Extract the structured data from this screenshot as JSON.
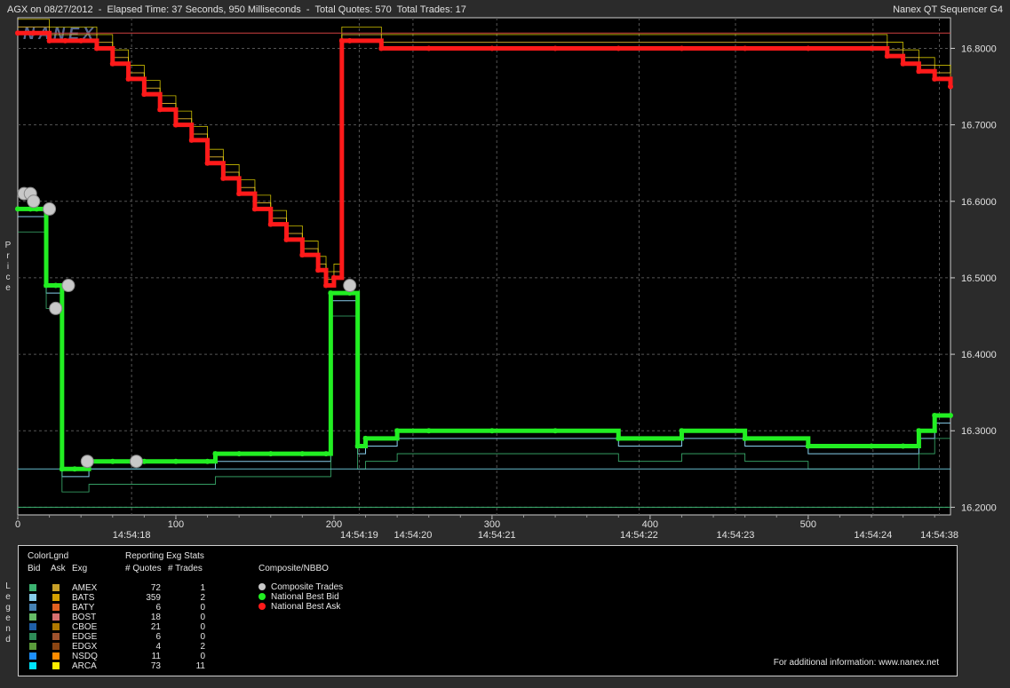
{
  "header": {
    "left_text": "AGX on 08/27/2012  -  Elapsed Time: 37 Seconds, 950 Milliseconds  -  Total Quotes: 570  Total Trades: 17",
    "right_text": "Nanex QT Sequencer G4"
  },
  "watermark": "NANEX",
  "y_axis_label": "Price",
  "legend_side_label": "Legend",
  "chart_data": {
    "type": "line",
    "x_range": [
      0,
      590
    ],
    "y_range": [
      16.19,
      16.84
    ],
    "grid": true,
    "y_ticks": [
      {
        "value": 16.8,
        "label": "16.8000"
      },
      {
        "value": 16.7,
        "label": "16.7000"
      },
      {
        "value": 16.6,
        "label": "16.6000"
      },
      {
        "value": 16.5,
        "label": "16.5000"
      },
      {
        "value": 16.4,
        "label": "16.4000"
      },
      {
        "value": 16.3,
        "label": "16.3000"
      },
      {
        "value": 16.2,
        "label": "16.2000"
      }
    ],
    "x_ticks": [
      {
        "value": 0,
        "label": "0"
      },
      {
        "value": 100,
        "label": "100"
      },
      {
        "value": 200,
        "label": "200"
      },
      {
        "value": 300,
        "label": "300"
      },
      {
        "value": 400,
        "label": "400"
      },
      {
        "value": 500,
        "label": "500"
      }
    ],
    "time_labels": [
      {
        "value": 72,
        "label": "14:54:18"
      },
      {
        "value": 216,
        "label": "14:54:19"
      },
      {
        "value": 250,
        "label": "14:54:20"
      },
      {
        "value": 303,
        "label": "14:54:21"
      },
      {
        "value": 393,
        "label": "14:54:22"
      },
      {
        "value": 454,
        "label": "14:54:23"
      },
      {
        "value": 541,
        "label": "14:54:24"
      },
      {
        "value": 583,
        "label": "14:54:38"
      }
    ],
    "series": [
      {
        "name": "National Best Ask",
        "color": "#ff1a1a",
        "x": [
          0,
          10,
          20,
          30,
          40,
          50,
          60,
          70,
          80,
          90,
          100,
          110,
          120,
          130,
          140,
          150,
          160,
          170,
          180,
          190,
          195,
          200,
          205,
          210,
          230,
          260,
          300,
          340,
          380,
          420,
          460,
          500,
          540,
          550,
          560,
          570,
          580,
          590
        ],
        "y": [
          16.82,
          16.82,
          16.81,
          16.81,
          16.81,
          16.8,
          16.78,
          16.76,
          16.74,
          16.72,
          16.7,
          16.68,
          16.65,
          16.63,
          16.61,
          16.59,
          16.57,
          16.55,
          16.53,
          16.51,
          16.49,
          16.5,
          16.81,
          16.81,
          16.8,
          16.8,
          16.8,
          16.8,
          16.8,
          16.8,
          16.8,
          16.8,
          16.8,
          16.79,
          16.78,
          16.77,
          16.76,
          16.75
        ]
      },
      {
        "name": "National Best Bid",
        "color": "#22ee22",
        "x": [
          0,
          8,
          12,
          18,
          24,
          28,
          36,
          45,
          60,
          80,
          100,
          120,
          125,
          140,
          160,
          180,
          195,
          198,
          210,
          215,
          220,
          240,
          260,
          300,
          340,
          380,
          420,
          460,
          500,
          540,
          560,
          570,
          580,
          590
        ],
        "y": [
          16.59,
          16.59,
          16.59,
          16.49,
          16.49,
          16.25,
          16.25,
          16.26,
          16.26,
          16.26,
          16.26,
          16.26,
          16.27,
          16.27,
          16.27,
          16.27,
          16.27,
          16.48,
          16.48,
          16.28,
          16.29,
          16.3,
          16.3,
          16.3,
          16.3,
          16.29,
          16.3,
          16.29,
          16.28,
          16.28,
          16.28,
          16.3,
          16.32,
          16.32
        ]
      }
    ],
    "composite_trades": {
      "x": [
        4,
        8,
        10,
        20,
        32,
        24,
        44,
        75,
        210
      ],
      "y": [
        16.61,
        16.61,
        16.6,
        16.59,
        16.49,
        16.46,
        16.26,
        16.26,
        16.49
      ]
    }
  },
  "legend": {
    "color_header": "ColorLgnd",
    "bid_header": "Bid",
    "ask_header": "Ask",
    "exg_header": "Exg",
    "stats_header": "Reporting Exg Stats",
    "quotes_header": "# Quotes",
    "trades_header": "# Trades",
    "composite_header": "Composite/NBBO",
    "exchanges": [
      {
        "name": "AMEX",
        "quotes": "72",
        "trades": "1",
        "bid_color": "#3cb371",
        "ask_color": "#c8a028"
      },
      {
        "name": "BATS",
        "quotes": "359",
        "trades": "2",
        "bid_color": "#87ceeb",
        "ask_color": "#d4a000"
      },
      {
        "name": "BATY",
        "quotes": "6",
        "trades": "0",
        "bid_color": "#4682b4",
        "ask_color": "#e06020"
      },
      {
        "name": "BOST",
        "quotes": "18",
        "trades": "0",
        "bid_color": "#66bb66",
        "ask_color": "#d87070"
      },
      {
        "name": "CBOE",
        "quotes": "21",
        "trades": "0",
        "bid_color": "#1f5fa8",
        "ask_color": "#b07800"
      },
      {
        "name": "EDGE",
        "quotes": "6",
        "trades": "0",
        "bid_color": "#2e8b57",
        "ask_color": "#a0522d"
      },
      {
        "name": "EDGX",
        "quotes": "4",
        "trades": "2",
        "bid_color": "#5b9b3b",
        "ask_color": "#8b4513"
      },
      {
        "name": "NSDQ",
        "quotes": "11",
        "trades": "0",
        "bid_color": "#1e90ff",
        "ask_color": "#ff8c00"
      },
      {
        "name": "ARCA",
        "quotes": "73",
        "trades": "11",
        "bid_color": "#00e5ff",
        "ask_color": "#ffee00"
      }
    ],
    "nbbo_items": [
      {
        "label": "Composite Trades",
        "color": "#c8c8c8"
      },
      {
        "label": "National Best Bid",
        "color": "#22ee22"
      },
      {
        "label": "National Best Ask",
        "color": "#ff1a1a"
      }
    ],
    "footer": "For additional information: www.nanex.net"
  }
}
